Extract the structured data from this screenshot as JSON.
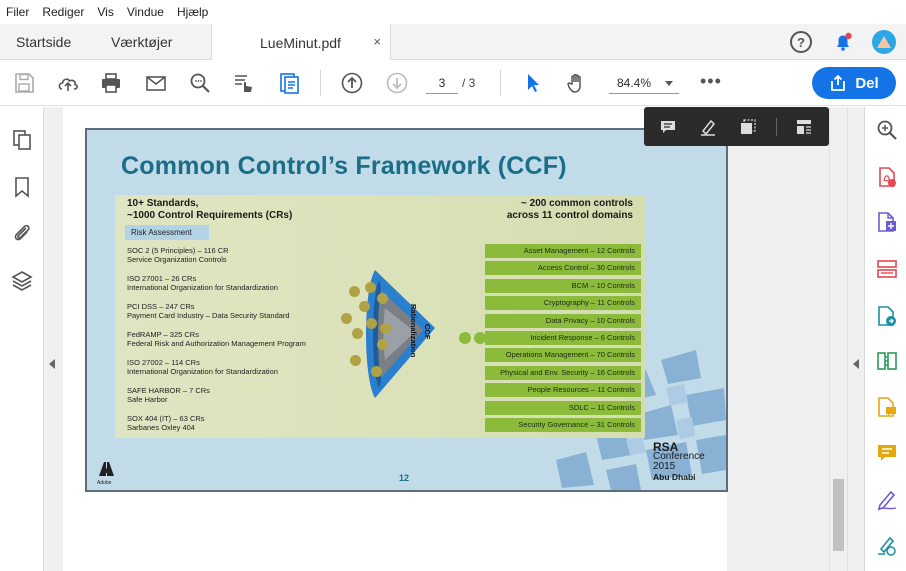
{
  "menu": [
    "Filer",
    "Rediger",
    "Vis",
    "Vindue",
    "Hjælp"
  ],
  "tabs": {
    "home": "Startside",
    "tools": "Værktøjer",
    "document": "LueMinut.pdf",
    "close": "×"
  },
  "header": {
    "help_glyph": "?"
  },
  "toolbar": {
    "current_page": "3",
    "page_total": "/ 3",
    "zoom": "84.4%",
    "more": "•••",
    "share_label": "Del"
  },
  "slide": {
    "title": "Common Control’s Framework (CCF)",
    "left_header": [
      "10+ Standards,",
      "~1000 Control Requirements (CRs)"
    ],
    "risk_tab": "Risk Assessment",
    "standards": [
      [
        "SOC 2 (5 Principles) – 116 CR",
        "Service Organization Controls"
      ],
      [
        "ISO 27001 – 26 CRs",
        "International Organization  for Standardization"
      ],
      [
        "PCI DSS – 247 CRs",
        "Payment Card Industry – Data Security Standard"
      ],
      [
        "FedRAMP – 325 CRs",
        "Federal Risk and Authorization  Management Program"
      ],
      [
        "ISO 27002 – 114 CRs",
        "International Organization  for Standardization"
      ],
      [
        "SAFE HARBOR – 7 CRs",
        "Safe Harbor"
      ],
      [
        "SOX 404 (IT) – 63 CRs",
        "Sarbanes Oxley 404"
      ]
    ],
    "right_header": [
      "~ 200 common controls",
      "across 11 control domains"
    ],
    "controls": [
      "Asset Management – 12 Controls",
      "Access Control – 30 Controls",
      "BCM – 10 Controls",
      "Cryptography – 11 Controls",
      "Data Privacy – 10 Controls",
      "Incident Response – 6 Controls",
      "Operations Management – 70 Controls",
      "Physical and Env. Security – 16 Controls",
      "People Resources – 11 Controls",
      "SDLC – 11 Controls",
      "Security Governance – 31 Controls"
    ],
    "funnel_label": [
      "CCF",
      "Rationalization"
    ],
    "page_number": "12",
    "adobe_label": "Adobe",
    "rsa": {
      "brand": "RSA",
      "line1": "Conference",
      "line2": "2015",
      "city": "Abu Dhabi"
    }
  },
  "colors": {
    "accent": "#1473e6",
    "slide_bg": "#c2dbe9",
    "title": "#1a6e86",
    "control_green": "#8cbb3c",
    "funnel": "#2a7fcf"
  },
  "icons": {
    "left_panel": [
      "pages-icon",
      "bookmark-icon",
      "attachment-icon",
      "layers-icon"
    ],
    "right_panel": [
      "zoom-icon",
      "export-pdf-icon",
      "create-pdf-icon",
      "organize-pages-icon",
      "edit-pdf-icon",
      "compress-icon",
      "comment-doc-icon",
      "comment-icon",
      "sign-icon",
      "fill-sign-icon"
    ]
  }
}
